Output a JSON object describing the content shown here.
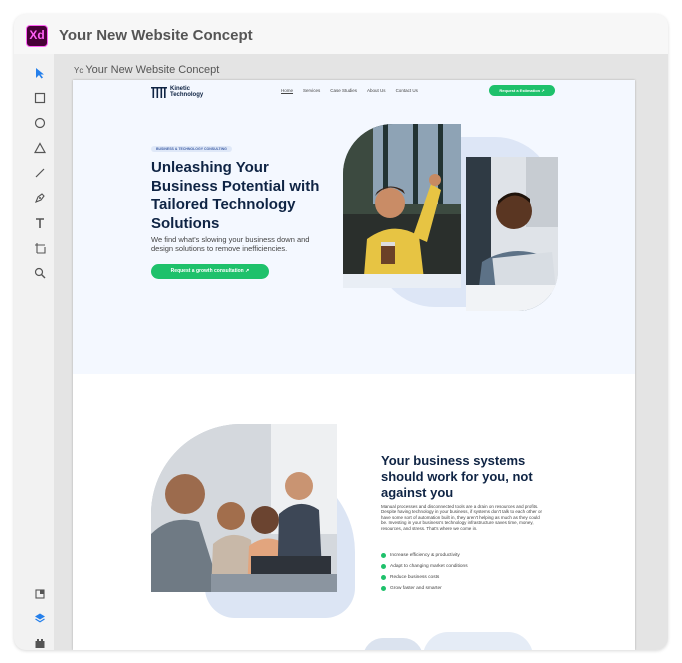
{
  "app": {
    "logo_text": "Xd",
    "title": "Your New Website Concept",
    "artboard_label": "Your New Website Concept",
    "artboard_prefix": "Yc"
  },
  "toolbar": {
    "tools": [
      "select-tool",
      "rectangle-tool",
      "ellipse-tool",
      "polygon-tool",
      "line-tool",
      "pen-tool",
      "text-tool",
      "artboard-tool",
      "zoom-tool"
    ],
    "bottom_tools": [
      "assets-panel",
      "layers-panel",
      "plugins-panel"
    ],
    "active_color": "#2680eb"
  },
  "site": {
    "brand": "Kinetic Technology",
    "nav": {
      "links": [
        "Home",
        "Services",
        "Case Studies",
        "About Us",
        "Contact Us"
      ],
      "cta": "Request a Estimation ↗"
    },
    "hero": {
      "tag": "BUSINESS & TECHNOLOGY CONSULTING",
      "headline": "Unleashing Your Business Potential with Tailored Technology Solutions",
      "subtext": "We find what's slowing your business down and design solutions to remove inefficiencies.",
      "cta": "Request a growth consultation ↗"
    },
    "section2": {
      "title": "Your business systems should work for you, not against you",
      "body": "Manual processes and disconnected tools are a drain on resources and profits. Despite having technology in your business, if systems don't talk to each other or have some sort of automation built in, they aren't helping as much as they could be. Investing in your business's technology infrastructure saves time, money, resources, and stress. That's where we come in.",
      "bullets": [
        "Increase efficiency & productivity",
        "Adapt to changing market conditions",
        "Reduce business costs",
        "Grow faster and smarter"
      ]
    }
  },
  "colors": {
    "accent_green": "#1ec16b",
    "navy": "#0f2444",
    "hero_bg": "#f4f8ff",
    "xd_purple": "#470137",
    "xd_pink": "#ff61f6"
  }
}
